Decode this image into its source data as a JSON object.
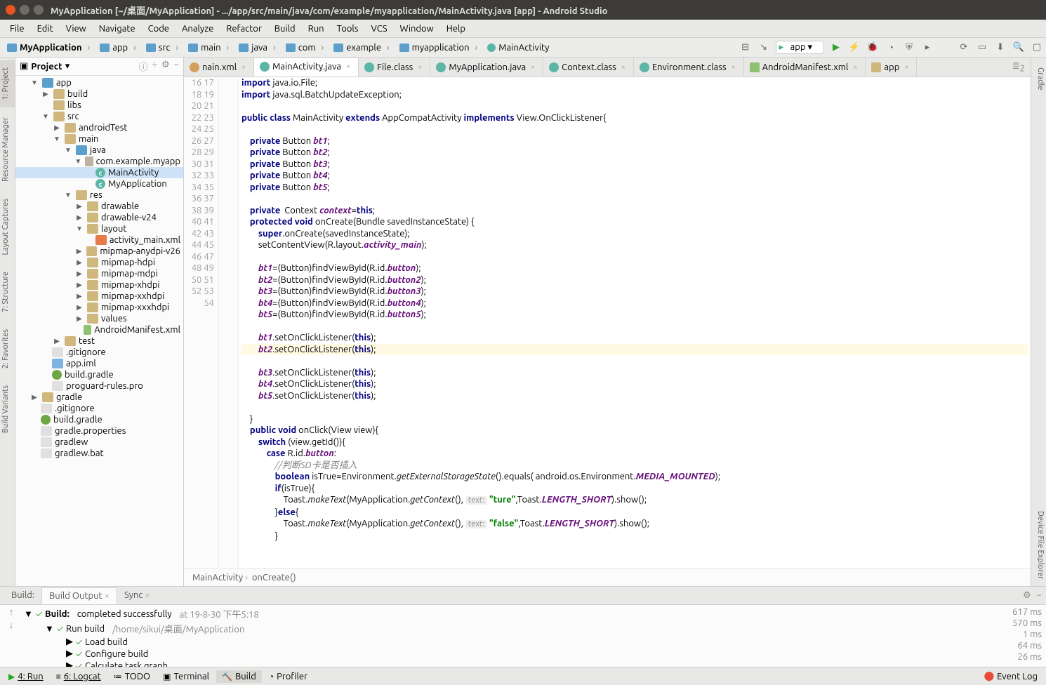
{
  "window": {
    "title": "MyApplication [~/桌面/MyApplication] - .../app/src/main/java/com/example/myapplication/MainActivity.java [app] - Android Studio"
  },
  "menu": [
    "File",
    "Edit",
    "View",
    "Navigate",
    "Code",
    "Analyze",
    "Refactor",
    "Build",
    "Run",
    "Tools",
    "VCS",
    "Window",
    "Help"
  ],
  "breadcrumbs": [
    "MyApplication",
    "app",
    "src",
    "main",
    "java",
    "com",
    "example",
    "myapplication",
    "MainActivity"
  ],
  "run_config": "app",
  "project_panel": {
    "label": "Project",
    "tree": {
      "app": "app",
      "build": "build",
      "libs": "libs",
      "src": "src",
      "androidTest": "androidTest",
      "main": "main",
      "java": "java",
      "pkg": "com.example.myapp",
      "MainActivity": "MainActivity",
      "MyApplication": "MyApplication",
      "res": "res",
      "drawable": "drawable",
      "drawable_v24": "drawable-v24",
      "layout": "layout",
      "activity_main": "activity_main.xml",
      "mipmap_anydpi": "mipmap-anydpi-v26",
      "mipmap_hdpi": "mipmap-hdpi",
      "mipmap_mdpi": "mipmap-mdpi",
      "mipmap_xhdpi": "mipmap-xhdpi",
      "mipmap_xxhdpi": "mipmap-xxhdpi",
      "mipmap_xxxhdpi": "mipmap-xxxhdpi",
      "values": "values",
      "AndroidManifest": "AndroidManifest.xml",
      "test": "test",
      "gitignore": ".gitignore",
      "app_iml": "app.iml",
      "build_gradle": "build.gradle",
      "proguard": "proguard-rules.pro",
      "gradle": "gradle",
      "gitignore2": ".gitignore",
      "build_gradle2": "build.gradle",
      "gradle_props": "gradle.properties",
      "gradlew": "gradlew",
      "gradlew_bat": "gradlew.bat"
    }
  },
  "left_tabs": [
    "1: Project",
    "Resource Manager",
    "Layout Captures",
    "7: Structure",
    "2: Favorites",
    "Build Variants"
  ],
  "right_tabs": [
    "Gradle",
    "Device File Explorer"
  ],
  "editor_tabs": [
    {
      "label": "nain.xml",
      "icon": "x"
    },
    {
      "label": "MainActivity.java",
      "icon": "c",
      "active": true
    },
    {
      "label": "File.class",
      "icon": "c"
    },
    {
      "label": "MyApplication.java",
      "icon": "c"
    },
    {
      "label": "Context.class",
      "icon": "c"
    },
    {
      "label": "Environment.class",
      "icon": "c"
    },
    {
      "label": "AndroidManifest.xml",
      "icon": "mf"
    },
    {
      "label": "app",
      "icon": "f"
    }
  ],
  "editor_crumbs": [
    "MainActivity",
    "onCreate()"
  ],
  "line_start": 16,
  "line_end": 54,
  "build": {
    "tabs": [
      "Build:",
      "Build Output",
      "Sync"
    ],
    "root_label": "Build:",
    "root_status": "completed successfully",
    "root_time": "at 19-8-30 下午5:18",
    "items": [
      {
        "label": "Run build",
        "path": "/home/sikui/桌面/MyApplication",
        "time": "570 ms"
      },
      {
        "label": "Load build",
        "time": "1 ms"
      },
      {
        "label": "Configure build",
        "time": "64 ms"
      },
      {
        "label": "Calculate task graph",
        "time": "26 ms"
      }
    ],
    "root_ms": "617 ms"
  },
  "status_buttons": {
    "run": "4: Run",
    "logcat": "6: Logcat",
    "todo": "TODO",
    "terminal": "Terminal",
    "build": "Build",
    "profiler": "Profiler",
    "event_log": "Event Log"
  }
}
